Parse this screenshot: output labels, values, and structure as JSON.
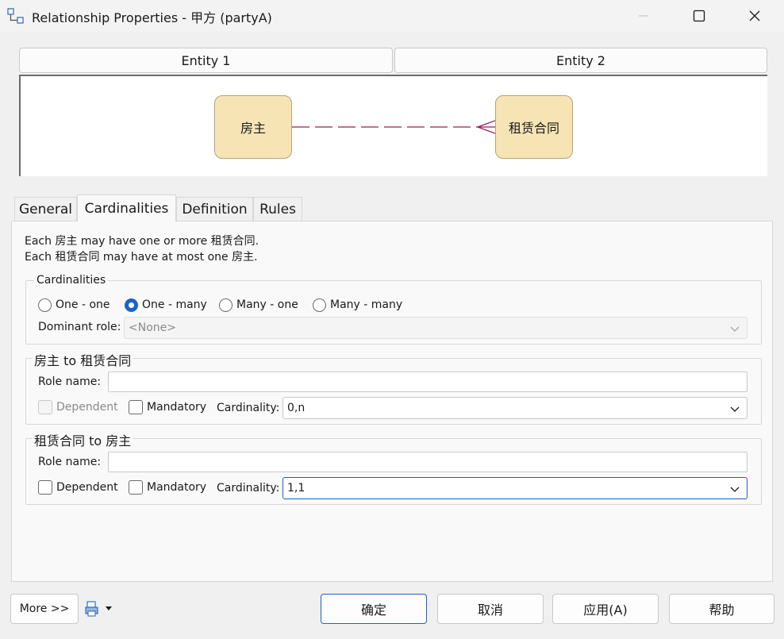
{
  "window": {
    "title": "Relationship Properties - 甲方 (partyA)",
    "controls": [
      "minimize-icon",
      "maximize-icon",
      "close-icon"
    ]
  },
  "entities": {
    "entity1_header": "Entity 1",
    "entity2_header": "Entity 2",
    "entity1_name": "房主",
    "entity2_name": "租赁合同",
    "box_color": "#f7e4b5",
    "line_color": "#9b1c5a"
  },
  "tabs": [
    "General",
    "Cardinalities",
    "Definition",
    "Rules"
  ],
  "active_tab": "Cardinalities",
  "summary": {
    "line1": "Each 房主 may have one or more 租赁合同.",
    "line2": "Each 租赁合同 may have at most one 房主."
  },
  "cardinalities": {
    "legend": "Cardinalities",
    "options": [
      "One - one",
      "One - many",
      "Many - one",
      "Many - many"
    ],
    "selected": "One - many",
    "dominant_role_label": "Dominant role:",
    "dominant_role_value": "<None>"
  },
  "role_a": {
    "legend": "房主 to 租赁合同",
    "role_name_label": "Role name:",
    "role_name_value": "",
    "dependent_label": "Dependent",
    "mandatory_label": "Mandatory",
    "cardinality_label": "Cardinality:",
    "cardinality_value": "0,n"
  },
  "role_b": {
    "legend": "租赁合同 to 房主",
    "role_name_label": "Role name:",
    "role_name_value": "",
    "dependent_label": "Dependent",
    "mandatory_label": "Mandatory",
    "cardinality_label": "Cardinality:",
    "cardinality_value": "1,1"
  },
  "buttons": {
    "more": "More >>",
    "ok": "确定",
    "cancel": "取消",
    "apply": "应用(A)",
    "help": "帮助"
  },
  "accent_color": "#1a63c7"
}
